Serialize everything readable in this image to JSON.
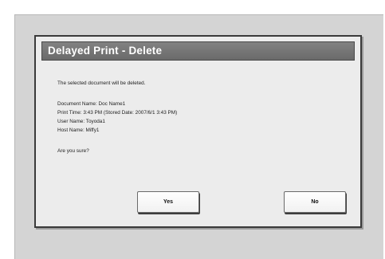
{
  "dialog": {
    "title": "Delayed Print - Delete",
    "message": "The selected document will be deleted.",
    "details": [
      "Document Name: Doc Name1",
      "Print Time: 3:43 PM (Stored Date: 2007/6/1 3:43 PM)",
      "User Name: Toyoda1",
      "Host Name: Miffy1"
    ],
    "question": "Are you sure?",
    "yes_label": "Yes",
    "no_label": "No"
  }
}
